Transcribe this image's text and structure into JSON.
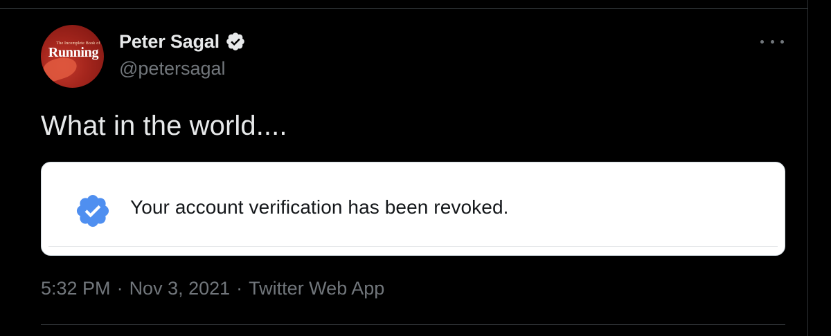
{
  "author": {
    "display_name": "Peter Sagal",
    "handle": "@petersagal",
    "avatar_caption": "The Incomplete Book of",
    "avatar_title": "Running",
    "verified": true
  },
  "tweet": {
    "text": "What in the world...."
  },
  "media_card": {
    "notice_text": "Your account verification has been revoked.",
    "badge_icon": "verified-badge-icon"
  },
  "meta": {
    "time": "5:32 PM",
    "separator": "·",
    "date": "Nov 3, 2021",
    "source": "Twitter Web App"
  },
  "colors": {
    "background": "#000000",
    "primary_text": "#e7e9ea",
    "secondary_text": "#71767b",
    "border": "#2f3336",
    "verified_blue": "#1d9bf0",
    "card_badge_blue": "#4f8ff0"
  },
  "icons": {
    "more": "more-horizontal-icon",
    "verified": "verified-checkmark-icon"
  }
}
